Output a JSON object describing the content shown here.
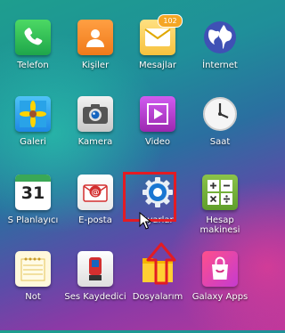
{
  "apps": [
    {
      "id": "phone",
      "label": "Telefon",
      "icon": "phone-icon"
    },
    {
      "id": "contacts",
      "label": "Kişiler",
      "icon": "contacts-icon"
    },
    {
      "id": "messages",
      "label": "Mesajlar",
      "icon": "message-icon",
      "badge": "102"
    },
    {
      "id": "internet",
      "label": "İnternet",
      "icon": "globe-icon"
    },
    {
      "id": "gallery",
      "label": "Galeri",
      "icon": "gallery-icon"
    },
    {
      "id": "camera",
      "label": "Kamera",
      "icon": "camera-icon"
    },
    {
      "id": "video",
      "label": "Video",
      "icon": "video-play-icon"
    },
    {
      "id": "clock",
      "label": "Saat",
      "icon": "clock-icon"
    },
    {
      "id": "calendar",
      "label": "S Planlayıcı",
      "icon": "calendar-icon",
      "day": "31"
    },
    {
      "id": "email",
      "label": "E-posta",
      "icon": "email-icon"
    },
    {
      "id": "settings",
      "label": "Ayarlar",
      "icon": "gear-icon"
    },
    {
      "id": "calculator",
      "label": "Hesap makinesi",
      "icon": "calculator-icon"
    },
    {
      "id": "memo",
      "label": "Not",
      "icon": "notepad-icon"
    },
    {
      "id": "voice-recorder",
      "label": "Ses Kaydedici",
      "icon": "microphone-icon"
    },
    {
      "id": "my-files",
      "label": "Dosyalarım",
      "icon": "folder-icon"
    },
    {
      "id": "galaxy-apps",
      "label": "Galaxy Apps",
      "icon": "shopping-bag-icon"
    }
  ],
  "colors": {
    "highlight": "#e31b23",
    "badge": "#f5a623"
  }
}
